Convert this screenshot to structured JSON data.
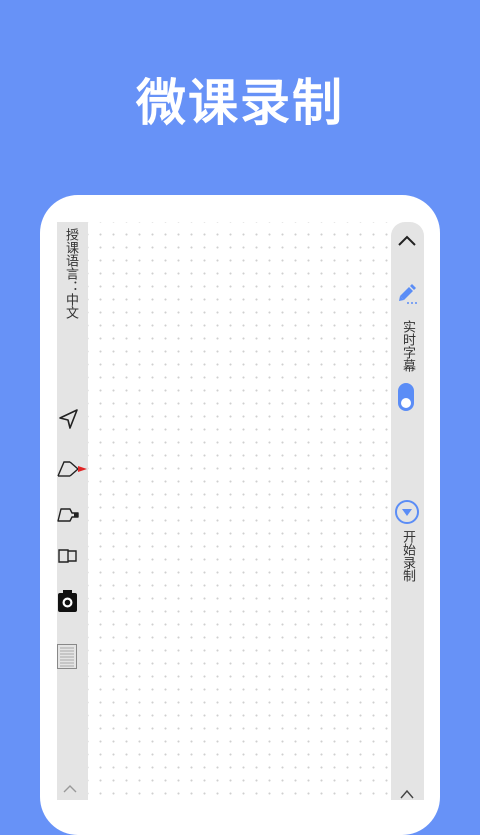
{
  "hero": {
    "title": "微课录制"
  },
  "left_panel": {
    "language_label": "授课语言：中文",
    "tools": [
      {
        "icon": "pointer-arrow-icon"
      },
      {
        "icon": "red-pen-icon",
        "selected": true
      },
      {
        "icon": "marker-icon"
      },
      {
        "icon": "eraser-icon"
      },
      {
        "icon": "camera-icon"
      },
      {
        "icon": "ruler-icon"
      }
    ]
  },
  "right_panel": {
    "subtitle_label": "实时字幕",
    "subtitle_toggle_on": true,
    "record_label": "开始录制"
  },
  "colors": {
    "background": "#6792f7",
    "accent": "#5b8df6",
    "pen_red": "#e02424",
    "panel_gray": "#e4e4e4"
  }
}
